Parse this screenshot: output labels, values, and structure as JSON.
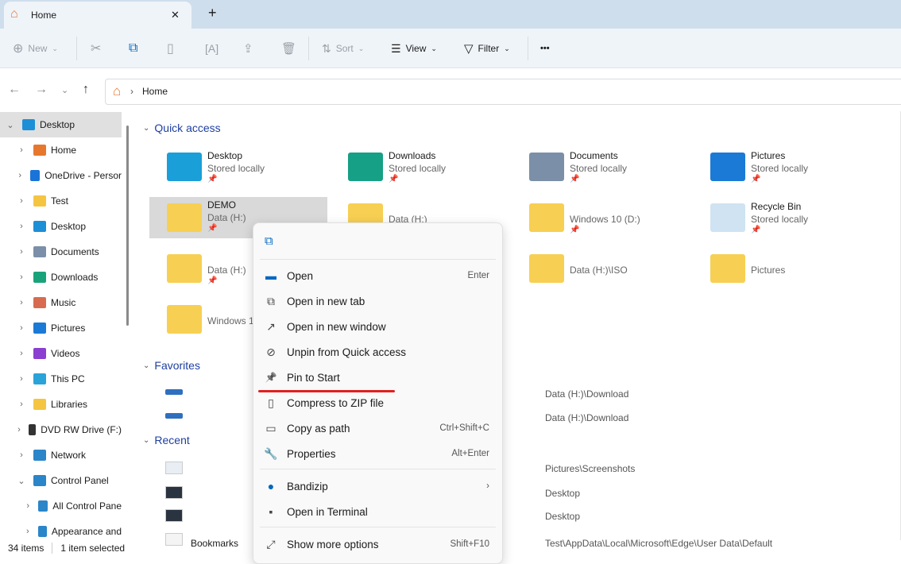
{
  "tab": {
    "title": "Home",
    "close": "✕",
    "new": "+"
  },
  "toolbar": {
    "new": "New",
    "sort": "Sort",
    "view": "View",
    "filter": "Filter",
    "more": "•••"
  },
  "address": {
    "crumb": "Home"
  },
  "sidebar": {
    "items": [
      {
        "label": "Desktop",
        "color": "#1d8fd6",
        "chev": "⌄"
      },
      {
        "label": "Home",
        "color": "#e8772e",
        "chev": "›"
      },
      {
        "label": "OneDrive - Persor",
        "color": "#1a73d9",
        "chev": "›"
      },
      {
        "label": "Test",
        "color": "#f5c542",
        "chev": "›"
      },
      {
        "label": "Desktop",
        "color": "#1d8fd6",
        "chev": "›"
      },
      {
        "label": "Documents",
        "color": "#7b8fa8",
        "chev": "›"
      },
      {
        "label": "Downloads",
        "color": "#1aa37a",
        "chev": "›"
      },
      {
        "label": "Music",
        "color": "#d86b4f",
        "chev": "›"
      },
      {
        "label": "Pictures",
        "color": "#1b7ad6",
        "chev": "›"
      },
      {
        "label": "Videos",
        "color": "#8a3fd1",
        "chev": "›"
      },
      {
        "label": "This PC",
        "color": "#2aa3d9",
        "chev": "›"
      },
      {
        "label": "Libraries",
        "color": "#f5c542",
        "chev": "›"
      },
      {
        "label": "DVD RW Drive (F:)",
        "color": "#333333",
        "chev": "›"
      },
      {
        "label": "Network",
        "color": "#2a85c9",
        "chev": "›"
      },
      {
        "label": "Control Panel",
        "color": "#2a85c9",
        "chev": "⌄"
      },
      {
        "label": "All Control Pane",
        "color": "#2a85c9",
        "chev": "›"
      },
      {
        "label": "Appearance and",
        "color": "#2a85c9",
        "chev": "›"
      }
    ]
  },
  "status": {
    "count": "34 items",
    "selected": "1 item selected"
  },
  "sections": {
    "quick": "Quick access",
    "favorites": "Favorites",
    "recent": "Recent"
  },
  "quick_access": [
    {
      "name": "Desktop",
      "sub": "Stored locally",
      "color": "#1a9fd8"
    },
    {
      "name": "Downloads",
      "sub": "Stored locally",
      "color": "#16a085"
    },
    {
      "name": "Documents",
      "sub": "Stored locally",
      "color": "#7b8fa8"
    },
    {
      "name": "Pictures",
      "sub": "Stored locally",
      "color": "#1b7ad6"
    },
    {
      "name": "DEMO",
      "sub": "Data (H:)",
      "color": "#f7cf52"
    },
    {
      "name": "",
      "sub": "Data (H:)",
      "color": "#f7cf52"
    },
    {
      "name": "",
      "sub": "Windows 10 (D:)",
      "color": "#f7cf52"
    },
    {
      "name": "Recycle Bin",
      "sub": "Stored locally",
      "color": "#cfe3f2"
    },
    {
      "name": "",
      "sub": "Data (H:)",
      "color": "#f7cf52"
    },
    {
      "name": "",
      "sub": "",
      "color": "#f7cf52"
    },
    {
      "name": "",
      "sub": "Data (H:)\\ISO",
      "color": "#f7cf52"
    },
    {
      "name": "",
      "sub": "Pictures",
      "color": "#f7cf52"
    },
    {
      "name": "",
      "sub": "Windows 1",
      "color": "#f7cf52"
    }
  ],
  "favorites": [
    {
      "path": "Data (H:)\\Download"
    },
    {
      "path": "Data (H:)\\Download"
    }
  ],
  "recent": [
    {
      "name": "",
      "path": "Pictures\\Screenshots"
    },
    {
      "name": "",
      "path": "Desktop"
    },
    {
      "name": "",
      "path": "Desktop"
    },
    {
      "name": "Bookmarks",
      "path": "Test\\AppData\\Local\\Microsoft\\Edge\\User Data\\Default"
    }
  ],
  "context_menu": {
    "items": [
      {
        "label": "Open",
        "shortcut": "Enter",
        "icon": "▬"
      },
      {
        "label": "Open in new tab",
        "shortcut": "",
        "icon": "⧉"
      },
      {
        "label": "Open in new window",
        "shortcut": "",
        "icon": "↗"
      },
      {
        "label": "Unpin from Quick access",
        "shortcut": "",
        "icon": "⊘"
      },
      {
        "label": "Pin to Start",
        "shortcut": "",
        "icon": "📌"
      },
      {
        "label": "Compress to ZIP file",
        "shortcut": "",
        "icon": "▯"
      },
      {
        "label": "Copy as path",
        "shortcut": "Ctrl+Shift+C",
        "icon": "▭"
      },
      {
        "label": "Properties",
        "shortcut": "Alt+Enter",
        "icon": "🔧"
      },
      {
        "label": "Bandizip",
        "shortcut": "›",
        "icon": "●"
      },
      {
        "label": "Open in Terminal",
        "shortcut": "",
        "icon": "▪"
      },
      {
        "label": "Show more options",
        "shortcut": "Shift+F10",
        "icon": "⤢"
      }
    ]
  },
  "colors": {
    "accent": "#0067c0",
    "highlight_underline": "#e02020",
    "selection": "#d9d9d9"
  }
}
